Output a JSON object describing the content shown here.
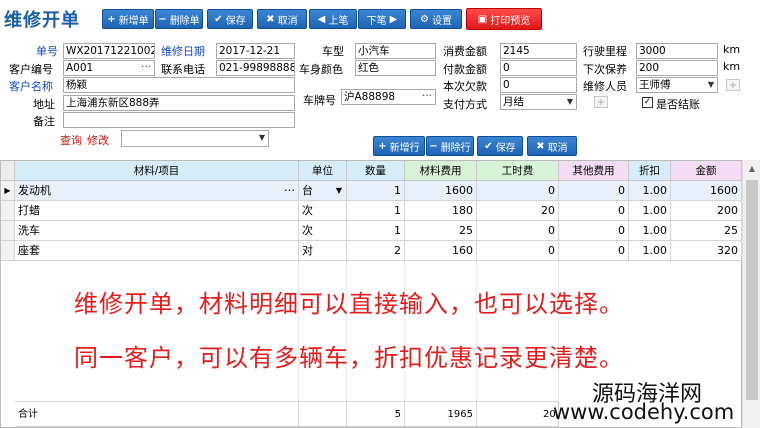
{
  "title": "维修开单",
  "toolbar": {
    "new": "新增单",
    "delete": "删除单",
    "save": "保存",
    "cancel": "取消",
    "prev": "上笔",
    "next": "下笔",
    "settings": "设置",
    "print": "打印预览"
  },
  "form": {
    "order_no_label": "单号",
    "order_no": "WX20171221002",
    "repair_date_label": "维修日期",
    "repair_date": "2017-12-21",
    "car_type_label": "车型",
    "car_type": "小汽车",
    "consume_label": "消费金额",
    "consume": "2145",
    "mileage_label": "行驶里程",
    "mileage": "3000",
    "mileage_unit": "km",
    "cust_no_label": "客户编号",
    "cust_no": "A001",
    "phone_label": "联系电话",
    "phone": "021-99898888",
    "body_color_label": "车身颜色",
    "body_color": "红色",
    "paid_label": "付款金额",
    "paid": "0",
    "next_maint_label": "下次保养",
    "next_maint": "200",
    "next_maint_unit": "km",
    "cust_name_label": "客户名称",
    "cust_name": "杨颖",
    "debt_label": "本次欠款",
    "debt": "0",
    "tech_label": "维修人员",
    "tech": "王师傅",
    "address_label": "地址",
    "address": "上海浦东新区888弄",
    "plate_label": "车牌号",
    "plate": "沪A88898",
    "pay_method_label": "支付方式",
    "pay_method": "月结",
    "settled_label": "是否结账",
    "settled_mark": "✓",
    "remark_label": "备注",
    "remark": "",
    "query_label": "查询",
    "modify_label": "修改",
    "query_value": ""
  },
  "row_toolbar": {
    "add_row": "新增行",
    "delete_row": "删除行",
    "save": "保存",
    "cancel": "取消"
  },
  "grid": {
    "headers": [
      "材料/项目",
      "单位",
      "数量",
      "材料费用",
      "工时费",
      "其他费用",
      "折扣",
      "金额"
    ],
    "rows": [
      {
        "item": "发动机",
        "unit": "台",
        "qty": "1",
        "material": "1600",
        "labor": "0",
        "other": "0",
        "discount": "1.00",
        "amount": "1600"
      },
      {
        "item": "打蜡",
        "unit": "次",
        "qty": "1",
        "material": "180",
        "labor": "20",
        "other": "0",
        "discount": "1.00",
        "amount": "200"
      },
      {
        "item": "洗车",
        "unit": "次",
        "qty": "1",
        "material": "25",
        "labor": "0",
        "other": "0",
        "discount": "1.00",
        "amount": "25"
      },
      {
        "item": "座套",
        "unit": "对",
        "qty": "2",
        "material": "160",
        "labor": "0",
        "other": "0",
        "discount": "1.00",
        "amount": "320"
      }
    ],
    "total_label": "合计",
    "total_qty": "5",
    "total_material": "1965",
    "total_labor": "20"
  },
  "overlay": {
    "line1": "维修开单，材料明细可以直接输入，也可以选择。",
    "line2": "同一客户，可以有多辆车，折扣优惠记录更清楚。"
  },
  "watermark": {
    "line1": "源码海洋网",
    "line2": "www.codehy.com"
  },
  "colors": {
    "accent": "#1f64b5",
    "print": "#e01818",
    "header_blue": "#d6ecf8",
    "header_green": "#d8f2d8",
    "header_pink": "#f4dcf4"
  }
}
